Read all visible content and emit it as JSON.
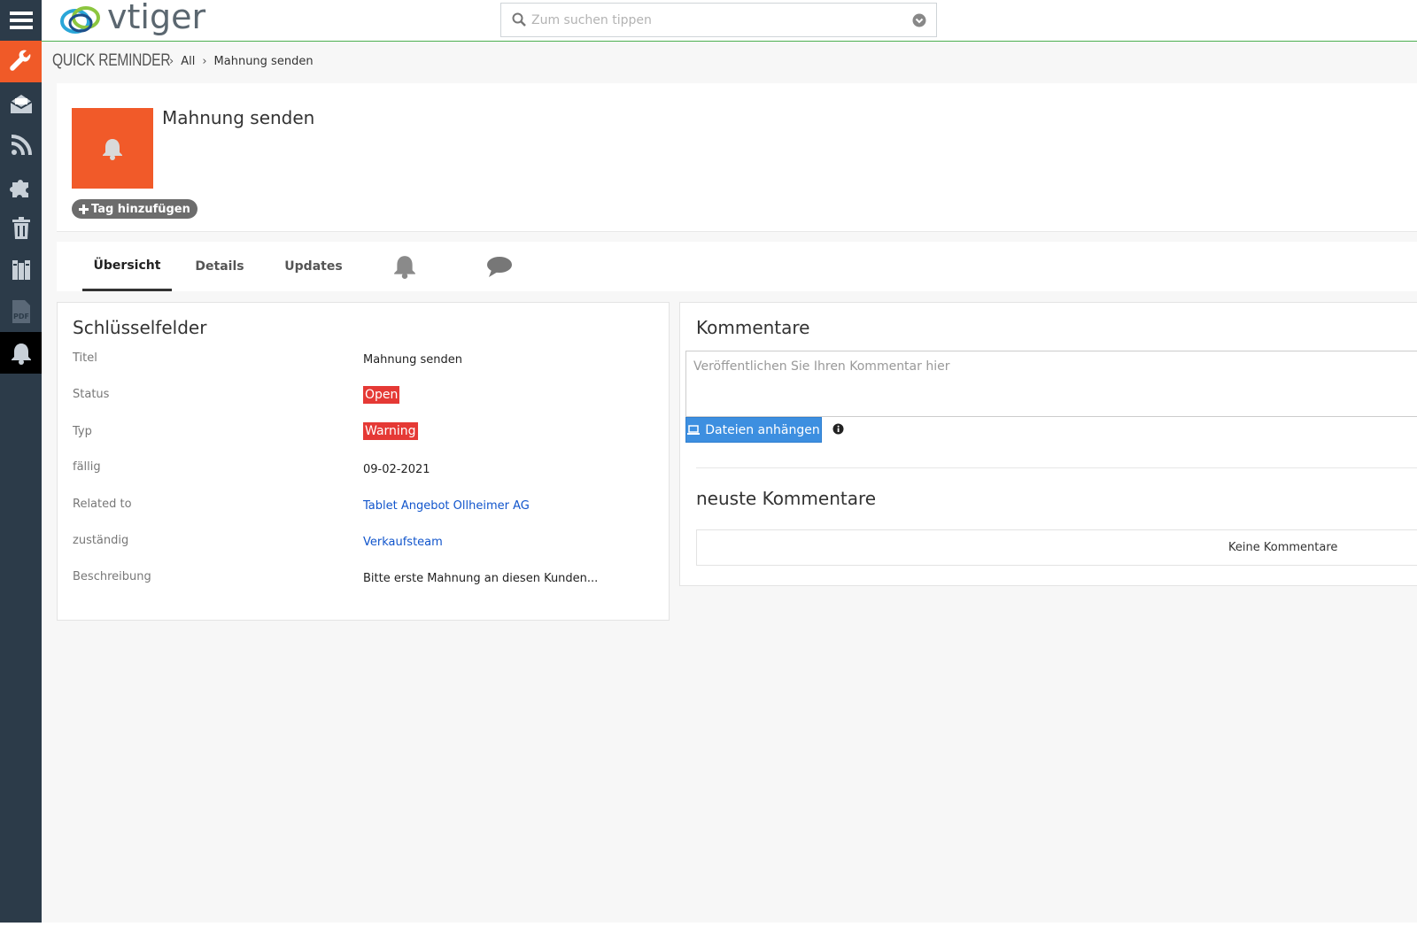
{
  "app": {
    "logo_text": "vtiger"
  },
  "search": {
    "placeholder": "Zum suchen tippen"
  },
  "sidebar": {
    "items": [
      {
        "icon": "menu-icon"
      },
      {
        "icon": "wrench-icon"
      },
      {
        "icon": "mail-icon"
      },
      {
        "icon": "rss-icon"
      },
      {
        "icon": "puzzle-icon"
      },
      {
        "icon": "trash-icon"
      },
      {
        "icon": "book-icon"
      },
      {
        "icon": "pdf-icon"
      },
      {
        "icon": "bell-icon"
      }
    ]
  },
  "breadcrumb": {
    "module": "QUICK REMINDER",
    "list": "All",
    "record": "Mahnung senden"
  },
  "record": {
    "title": "Mahnung senden",
    "tag_button": "Tag hinzufügen"
  },
  "tabs": [
    {
      "label": "Übersicht",
      "active": true
    },
    {
      "label": "Details"
    },
    {
      "label": "Updates"
    },
    {
      "icon": "bell-icon"
    },
    {
      "icon": "comment-icon"
    }
  ],
  "key_fields": {
    "heading": "Schlüsselfelder",
    "fields": [
      {
        "label": "Titel",
        "value": "Mahnung senden"
      },
      {
        "label": "Status",
        "value": "Open"
      },
      {
        "label": "Typ",
        "value": "Warning"
      },
      {
        "label": "fällig",
        "value": "09-02-2021"
      },
      {
        "label": "Related to",
        "value": "Tablet Angebot Ollheimer AG"
      },
      {
        "label": "zuständig",
        "value": "Verkaufsteam"
      },
      {
        "label": "Beschreibung",
        "value": "Bitte erste Mahnung an diesen Kunden..."
      }
    ]
  },
  "comments": {
    "heading": "Kommentare",
    "placeholder": "Veröffentlichen Sie Ihren Kommentar hier",
    "attach_button": "Dateien anhängen",
    "recent_heading": "neuste Kommentare",
    "empty_text": "Keine Kommentare"
  },
  "colors": {
    "sidebar": "#2c3b49",
    "accent_orange": "#f05a28",
    "badge_red": "#e53935",
    "link_blue": "#1155cc",
    "button_blue": "#3d8fe0",
    "topbar_border": "#4caf50"
  }
}
